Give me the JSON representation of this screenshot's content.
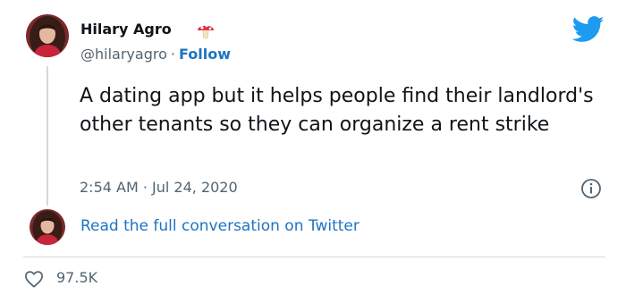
{
  "author": {
    "display_name": "Hilary Agro",
    "handle": "@hilaryagro",
    "separator": "·",
    "follow_label": "Follow",
    "badge_icon": "mushroom-icon",
    "avatar_icon": "avatar-photo"
  },
  "brand": {
    "icon": "twitter-bird-icon",
    "color": "#1d9bf0"
  },
  "tweet": {
    "text": "A dating app but it helps people find their landlord's other tenants so they can organize a rent strike",
    "timestamp": "2:54 AM · Jul 24, 2020",
    "info_icon": "info-icon"
  },
  "conversation": {
    "link_label": "Read the full conversation on Twitter"
  },
  "engagement": {
    "like_icon": "heart-icon",
    "like_count": "97.5K"
  },
  "colors": {
    "text": "#0f1419",
    "secondary": "#536471",
    "link": "#1d74c3",
    "border": "#cfd9de"
  }
}
